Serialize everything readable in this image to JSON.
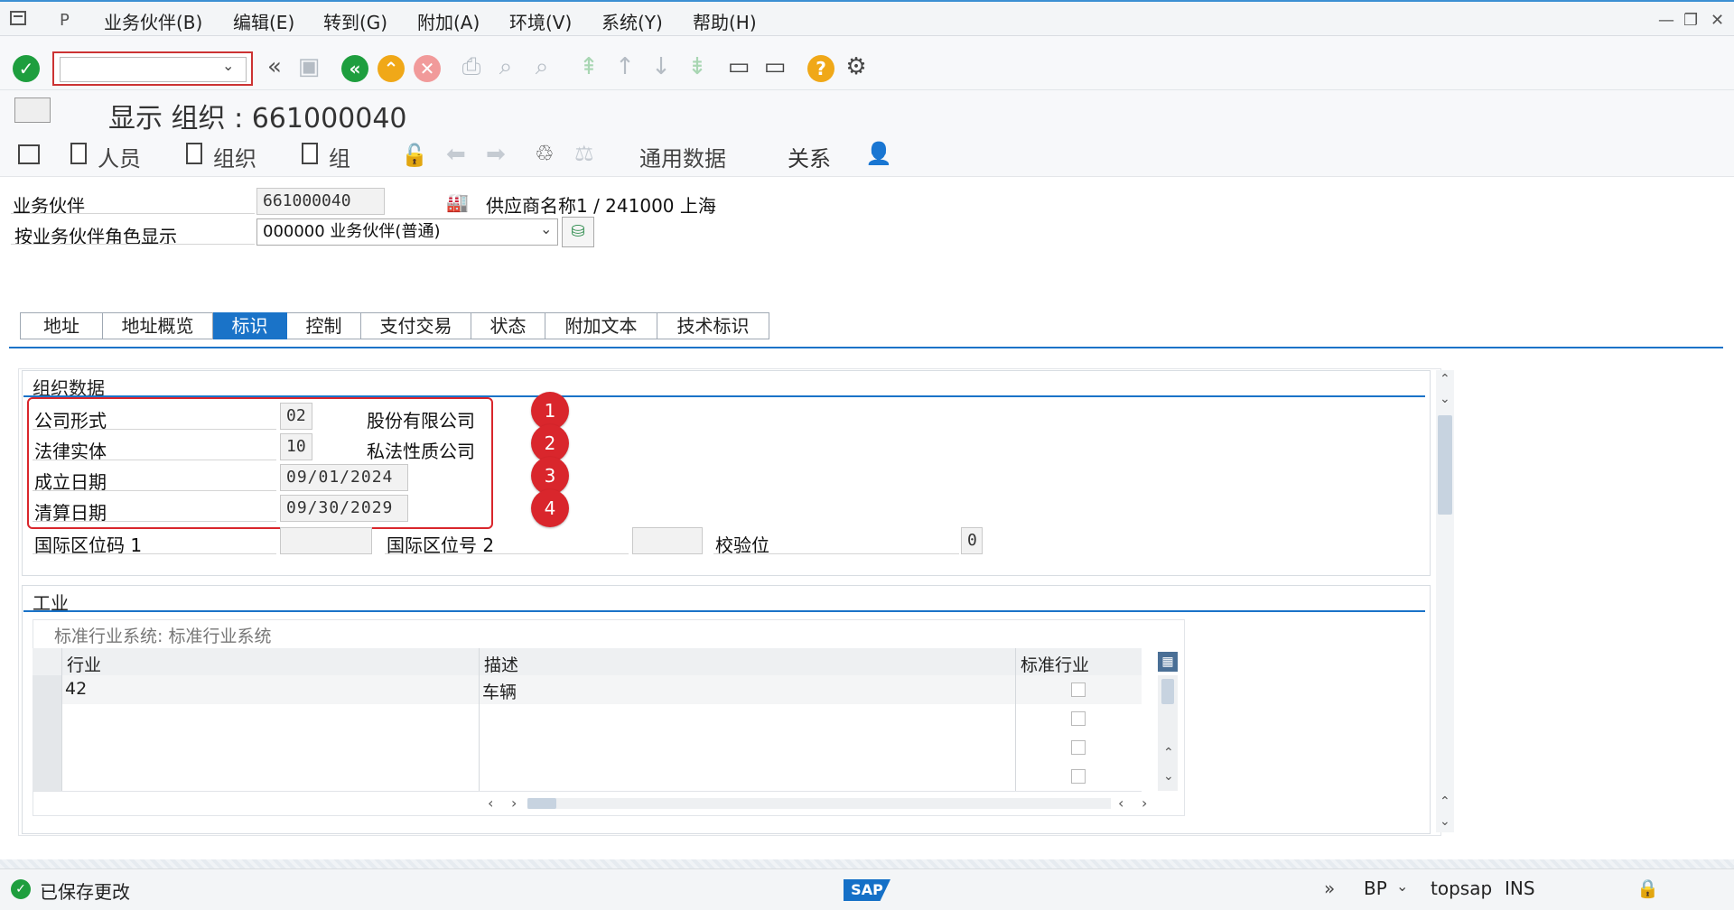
{
  "menu": {
    "items": [
      "业务伙伴(B)",
      "编辑(E)",
      "转到(G)",
      "附加(A)",
      "环境(V)",
      "系统(Y)",
      "帮助(H)"
    ]
  },
  "page": {
    "title": "显示 组织 : 661000040"
  },
  "app_toolbar": {
    "person": "人员",
    "organization": "组织",
    "group": "组",
    "general_data": "通用数据",
    "relations": "关系"
  },
  "header": {
    "bp_label": "业务伙伴",
    "bp_value": "661000040",
    "bp_description": "供应商名称1 / 241000 上海",
    "role_label": "按业务伙伴角色显示",
    "role_value": "000000 业务伙伴(普通)"
  },
  "tabs": [
    "地址",
    "地址概览",
    "标识",
    "控制",
    "支付交易",
    "状态",
    "附加文本",
    "技术标识"
  ],
  "active_tab": "标识",
  "org_data": {
    "title": "组织数据",
    "legal_form_label": "公司形式",
    "legal_form_code": "02",
    "legal_form_text": "股份有限公司",
    "legal_entity_label": "法律实体",
    "legal_entity_code": "10",
    "legal_entity_text": "私法性质公司",
    "founded_label": "成立日期",
    "founded_value": "09/01/2024",
    "liquidation_label": "清算日期",
    "liquidation_value": "09/30/2029",
    "intl_loc1_label": "国际区位码 1",
    "intl_loc2_label": "国际区位号 2",
    "check_digit_label": "校验位",
    "check_digit_value": "0",
    "badges": [
      "1",
      "2",
      "3",
      "4"
    ]
  },
  "industry": {
    "title": "工业",
    "system_label": "标准行业系统: 标准行业系统",
    "columns": [
      "行业",
      "描述",
      "标准行业"
    ],
    "rows": [
      {
        "industry": "42",
        "description": "车辆"
      },
      {
        "industry": "",
        "description": ""
      },
      {
        "industry": "",
        "description": ""
      },
      {
        "industry": "",
        "description": ""
      }
    ]
  },
  "status": {
    "message": "已保存更改",
    "transaction": "BP",
    "server": "topsap",
    "mode": "INS"
  },
  "colors": {
    "accent": "#1a73c8",
    "highlight_red": "#d9262c",
    "success_green": "#1e9e3e"
  }
}
